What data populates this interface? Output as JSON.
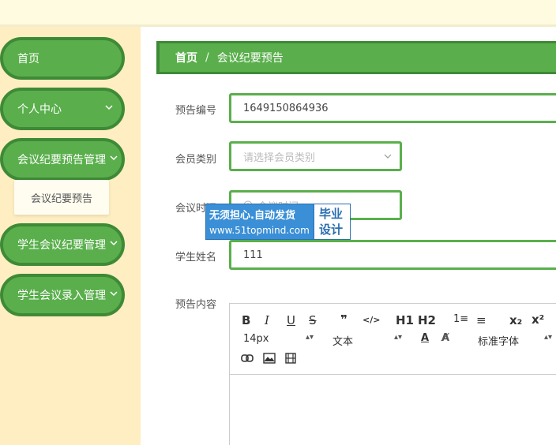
{
  "sidebar": {
    "items": [
      {
        "label": "首页"
      },
      {
        "label": "个人中心"
      },
      {
        "label": "会议纪要预告管理"
      },
      {
        "label": "学生会议纪要管理"
      },
      {
        "label": "学生会议录入管理"
      }
    ],
    "submenu_label": "会议纪要预告"
  },
  "breadcrumb": {
    "home": "首页",
    "separator": "/",
    "current": "会议纪要预告"
  },
  "form": {
    "notice_no_label": "预告编号",
    "notice_no_value": "1649150864936",
    "member_type_label": "会员类别",
    "member_type_placeholder": "请选择会员类别",
    "meeting_time_label": "会议时间",
    "meeting_time_placeholder": "会议时间",
    "student_name_label": "学生姓名",
    "student_name_value": "111",
    "content_label": "预告内容"
  },
  "editor": {
    "font_size": "14px",
    "text_style": "文本",
    "font_family": "标准字体",
    "tools": [
      "B",
      "I",
      "U",
      "S",
      "❞",
      "</>",
      "H1",
      "H2",
      "1≡",
      "≡",
      "x₂",
      "x²"
    ]
  },
  "watermark": {
    "line1": "无须担心.自动发货",
    "line2": "www.51topmind.com",
    "right1": "毕业",
    "right2": "设计"
  },
  "colors": {
    "primary": "#5aaf4c",
    "primary_dark": "#3e8a36",
    "sidebar_bg": "#ffeec2"
  }
}
